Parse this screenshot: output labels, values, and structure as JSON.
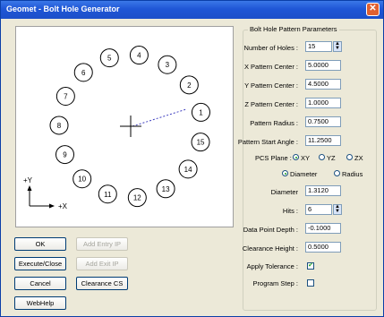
{
  "window": {
    "title": "Geomet - Bolt Hole Generator",
    "close_glyph": "✕"
  },
  "preview": {
    "holes": [
      "1",
      "2",
      "3",
      "4",
      "5",
      "6",
      "7",
      "8",
      "9",
      "10",
      "11",
      "12",
      "13",
      "14",
      "15"
    ],
    "axis_y": "+Y",
    "axis_x": "+X"
  },
  "buttons": {
    "ok": "OK",
    "add_entry": "Add Entry IP",
    "execute_close": "Execute/Close",
    "add_exit": "Add Exit IP",
    "cancel": "Cancel",
    "clearance_cs": "Clearance CS",
    "webhelp": "WebHelp"
  },
  "params": {
    "group_title": "Bolt Hole Pattern Parameters",
    "number_of_holes_label": "Number of Holes :",
    "number_of_holes": "15",
    "x_center_label": "X Pattern Center :",
    "x_center": "5.0000",
    "y_center_label": "Y Pattern Center :",
    "y_center": "4.5000",
    "z_center_label": "Z Pattern Center :",
    "z_center": "1.0000",
    "radius_label": "Pattern Radius :",
    "radius": "0.7500",
    "start_angle_label": "Pattern Start Angle :",
    "start_angle": "11.2500",
    "pcs_plane_label": "PCS Plane :",
    "plane_xy": "XY",
    "plane_yz": "YZ",
    "plane_zx": "ZX",
    "size_diameter": "Diameter",
    "size_radius": "Radius",
    "diameter_label": "Diameter",
    "diameter": "1.3120",
    "hits_label": "Hits :",
    "hits": "6",
    "depth_label": "Data Point Depth :",
    "depth": "-0.1000",
    "clearance_label": "Clearance Height :",
    "clearance": "0.5000",
    "apply_tol_label": "Apply Tolerance :",
    "apply_tol_mark": "✔",
    "program_step_label": "Program Step :"
  }
}
